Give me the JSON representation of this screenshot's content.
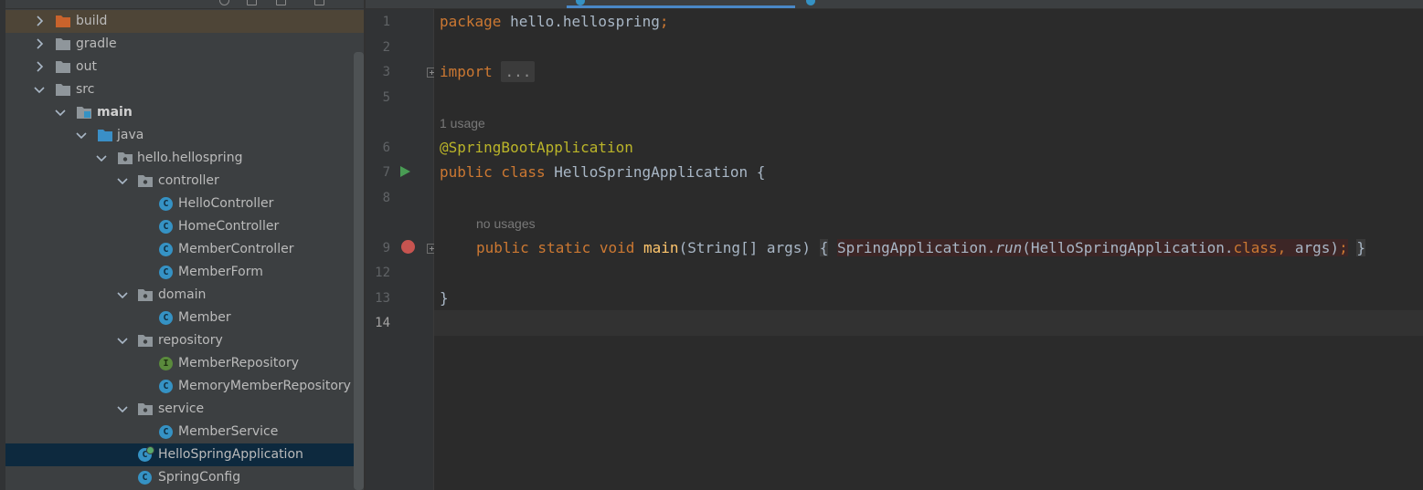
{
  "project_tree": {
    "items": [
      {
        "label": "build",
        "kind": "folder-excluded",
        "expanded": false
      },
      {
        "label": "gradle",
        "kind": "folder",
        "expanded": false
      },
      {
        "label": "out",
        "kind": "folder",
        "expanded": false
      },
      {
        "label": "src",
        "kind": "folder",
        "expanded": true
      },
      {
        "label": "main",
        "kind": "source-root-folder",
        "expanded": true
      },
      {
        "label": "java",
        "kind": "java-folder",
        "expanded": true
      },
      {
        "label": "hello.hellospring",
        "kind": "package",
        "expanded": true
      },
      {
        "label": "controller",
        "kind": "package",
        "expanded": true
      },
      {
        "label": "HelloController",
        "kind": "class"
      },
      {
        "label": "HomeController",
        "kind": "class"
      },
      {
        "label": "MemberController",
        "kind": "class"
      },
      {
        "label": "MemberForm",
        "kind": "class"
      },
      {
        "label": "domain",
        "kind": "package",
        "expanded": true
      },
      {
        "label": "Member",
        "kind": "class"
      },
      {
        "label": "repository",
        "kind": "package",
        "expanded": true
      },
      {
        "label": "MemberRepository",
        "kind": "interface"
      },
      {
        "label": "MemoryMemberRepository",
        "kind": "class"
      },
      {
        "label": "service",
        "kind": "package",
        "expanded": true
      },
      {
        "label": "MemberService",
        "kind": "class"
      },
      {
        "label": "HelloSpringApplication",
        "kind": "runnable-class",
        "selected": true
      },
      {
        "label": "SpringConfig",
        "kind": "class"
      }
    ],
    "class_icon_letter": "C",
    "interface_icon_letter": "I"
  },
  "editor": {
    "line_numbers": [
      "1",
      "2",
      "3",
      "5",
      "6",
      "7",
      "8",
      "9",
      "12",
      "13",
      "14"
    ],
    "current_line": "14",
    "hints": {
      "usage_hint": "1 usage",
      "no_usages_hint": "no usages"
    },
    "code": {
      "l1_kw": "package",
      "l1_pkg": " hello.hellospring",
      "l1_semi": ";",
      "l3_kw": "import",
      "l3_fold": "...",
      "l6_ann": "@SpringBootApplication",
      "l7_kw": "public class",
      "l7_rest": " HelloSpringApplication {",
      "l9_kw": "public static void",
      "l9_fn": "main",
      "l9_params": "(String[] args)",
      "l9_open": "{",
      "l9_call1": "SpringApplication.",
      "l9_call_run": "run",
      "l9_call2": "(HelloSpringApplication.",
      "l9_classkw": "class,",
      "l9_call3": " args)",
      "l9_semi": ";",
      "l9_close": "}",
      "l13_close": "}"
    }
  },
  "colors": {
    "keyword": "#cc7832",
    "annotation": "#bbb529",
    "method": "#ffc66d",
    "plain": "#a9b7c6",
    "class_icon": "#3592c4",
    "interface_icon": "#5a8a3c",
    "breakpoint": "#c75450",
    "run_icon": "#499c54",
    "selection": "#0d293e"
  }
}
